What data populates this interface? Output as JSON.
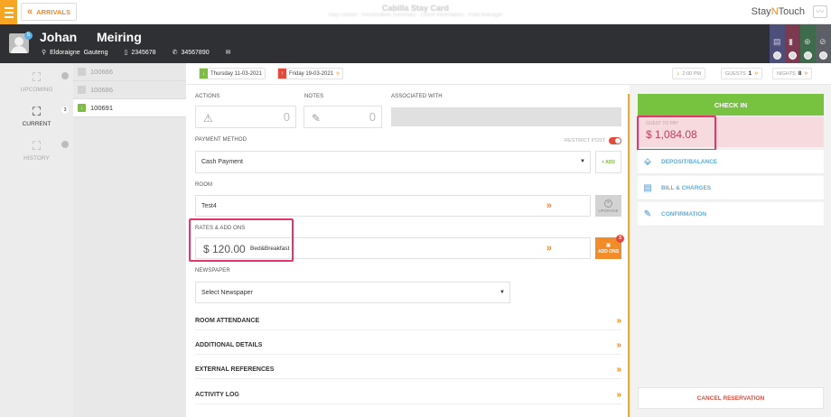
{
  "header": {
    "back_label": "ARRIVALS",
    "faded_title": "Cabilla   Stay Card",
    "faded_subtitle": "Stay Details  ·  Reservation Summary  ·  Guest Information  ·  Rate Manager",
    "logo_prefix": "Stay",
    "logo_n": "N",
    "logo_suffix": "Touch"
  },
  "guest": {
    "first_name": "Johan",
    "last_name": "Meiring",
    "vip_count": "5",
    "city": "Eldoraigne",
    "state": "Gauteng",
    "mobile": "2345678",
    "phone": "34567890"
  },
  "nav": {
    "upcoming": "UPCOMING",
    "current": "CURRENT",
    "current_count": "3",
    "history": "HISTORY"
  },
  "reservations": [
    {
      "number": "100666"
    },
    {
      "number": "100686"
    },
    {
      "number": "100691"
    }
  ],
  "dates": {
    "arrival": "Thursday 11-03-2021",
    "departure": "Friday 19-03-2021",
    "time": "2:00 PM",
    "guests_label": "GUESTS",
    "guests": "1",
    "nights_label": "NIGHTS",
    "nights": "8"
  },
  "stay": {
    "actions_label": "ACTIONS",
    "actions_count": "0",
    "notes_label": "NOTES",
    "notes_count": "0",
    "associated_label": "ASSOCIATED WITH",
    "payment_label": "PAYMENT METHOD",
    "restrict_post_label": "RESTRICT POST",
    "payment_value": "Cash Payment",
    "add_label": "+ ADD",
    "room_label": "ROOM",
    "room_value": "Test4",
    "upgrade_label": "UPGRADE",
    "rates_label": "RATES & ADD ONS",
    "rate_amount": "$ 120.00",
    "rate_name": "Bed&Breakfast",
    "addons_label": "ADD ONS",
    "addons_count": "3",
    "newspaper_label": "NEWSPAPER",
    "newspaper_value": "Select Newspaper"
  },
  "sections": [
    {
      "label": "ROOM ATTENDANCE"
    },
    {
      "label": "ADDITIONAL DETAILS"
    },
    {
      "label": "EXTERNAL REFERENCES"
    },
    {
      "label": "ACTIVITY LOG"
    }
  ],
  "right": {
    "checkin_label": "CHECK IN",
    "guest_to_pay_label": "GUEST TO PAY",
    "guest_to_pay_value": "$ 1,084.08",
    "deposit_label": "DEPOSIT/BALANCE",
    "bill_label": "BILL & CHARGES",
    "confirmation_label": "CONFIRMATION",
    "cancel_label": "CANCEL RESERVATION"
  },
  "colors": {
    "accent_orange": "#f08a24",
    "checkin_green": "#77c23e",
    "highlight_pink": "#e5356a",
    "header_dark": "#2f3033"
  },
  "icons": [
    "menu-icon",
    "chevron-left-icon",
    "location-icon",
    "mobile-icon",
    "phone-icon",
    "email-icon",
    "warning-icon",
    "pin-icon",
    "calendar-icon",
    "dropdown-icon"
  ]
}
